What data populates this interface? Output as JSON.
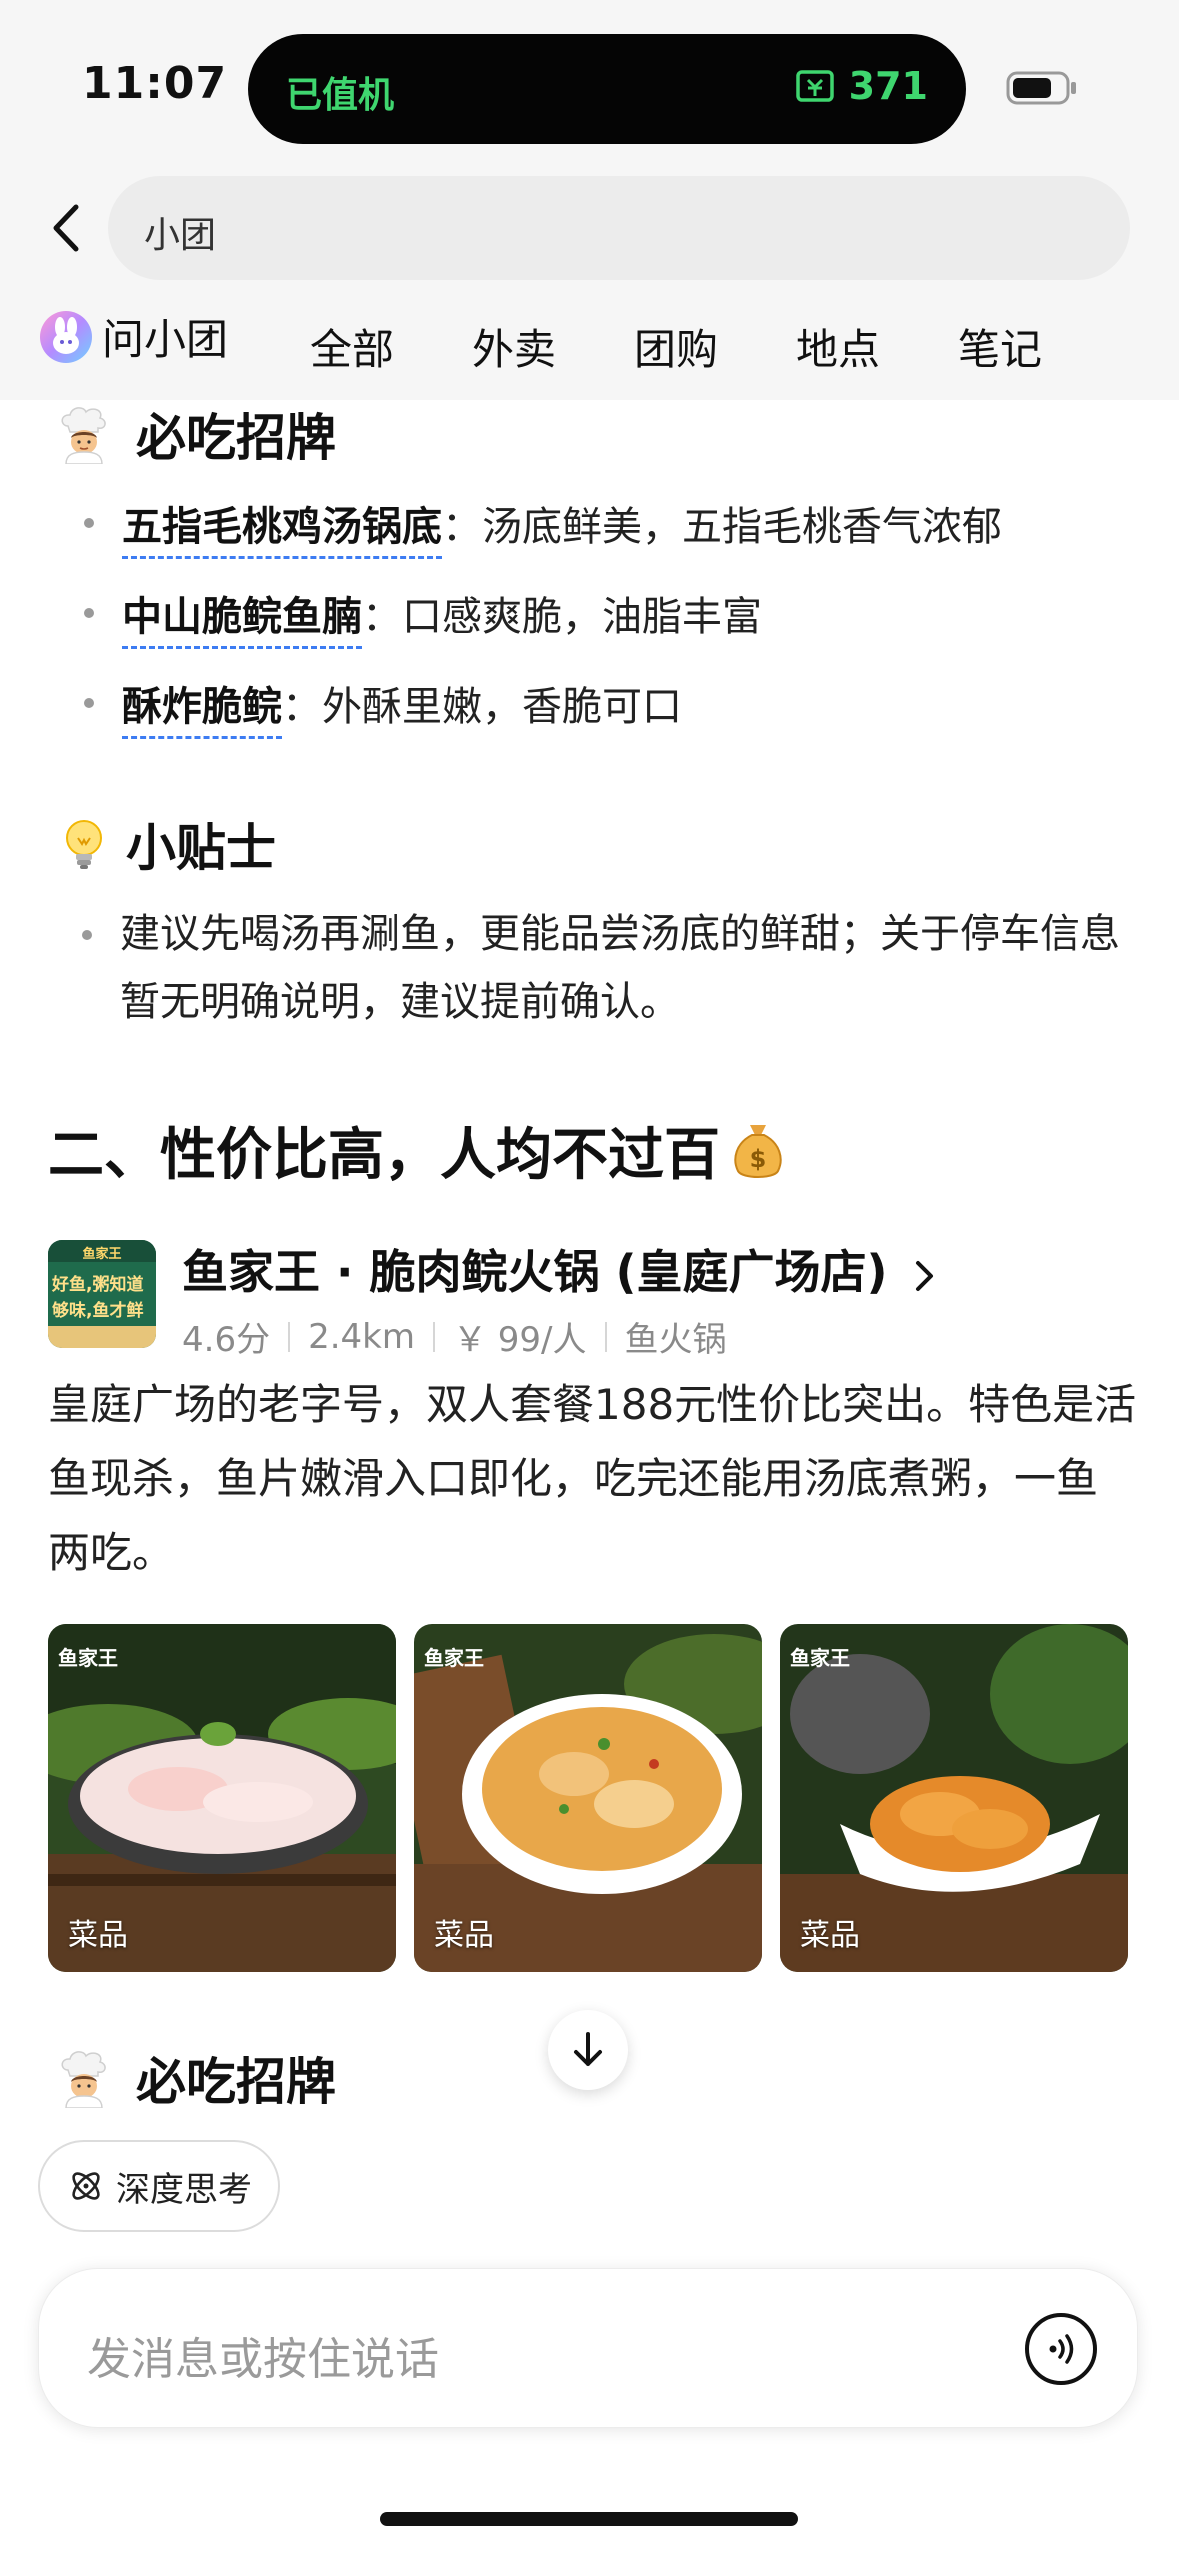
{
  "status_bar": {
    "time": "11:07",
    "island_left": "已值机",
    "island_right": "371",
    "accent_color": "#3fd66f"
  },
  "header": {
    "search_text": "小团",
    "tabs": [
      {
        "label": "问小团",
        "active": true
      },
      {
        "label": "全部"
      },
      {
        "label": "外卖"
      },
      {
        "label": "团购"
      },
      {
        "label": "地点"
      },
      {
        "label": "笔记"
      }
    ]
  },
  "section1": {
    "must_eat_title": "必吃招牌",
    "dishes": [
      {
        "name": "五指毛桃鸡汤锅底",
        "desc": "：汤底鲜美，五指毛桃香气浓郁"
      },
      {
        "name": "中山脆鲩鱼腩",
        "desc": "：口感爽脆，油脂丰富"
      },
      {
        "name": "酥炸脆鲩",
        "desc": "：外酥里嫩，香脆可口"
      }
    ],
    "tips_title": "小贴士",
    "tip_text": "建议先喝汤再涮鱼，更能品尝汤底的鲜甜；关于停车信息暂无明确说明，建议提前确认。"
  },
  "section2": {
    "title": "二、性价比高，人均不过百",
    "shop": {
      "name": "鱼家王 · 脆肉鲩火锅 (皇庭广场店)",
      "rating": "4.6分",
      "distance": "2.4km",
      "price": "￥ 99/人",
      "category": "鱼火锅",
      "logo_text_1": "鱼家王",
      "logo_text_2": "好鱼,粥知道",
      "logo_text_3": "够味,鱼才鲜"
    },
    "description": "皇庭广场的老字号，双人套餐188元性价比突出。特色是活鱼现杀，鱼片嫩滑入口即化，吃完还能用汤底煮粥，一鱼两吃。",
    "photos": [
      {
        "label": "菜品",
        "brand": "鱼家王"
      },
      {
        "label": "菜品",
        "brand": "鱼家王"
      },
      {
        "label": "菜品",
        "brand": "鱼家王"
      }
    ],
    "next_title": "必吃招牌"
  },
  "bottom": {
    "deep_think_label": "深度思考",
    "input_placeholder": "发消息或按住说话"
  }
}
